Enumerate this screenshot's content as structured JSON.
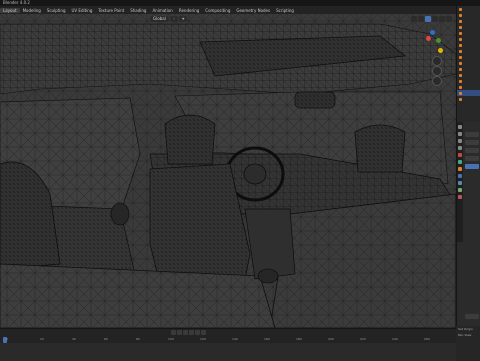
{
  "window": {
    "title": "Blender 4.0.2"
  },
  "menubar": {
    "items": [
      "Layout",
      "Modeling",
      "Sculpting",
      "UV Editing",
      "Texture Paint",
      "Shading",
      "Animation",
      "Rendering",
      "Compositing",
      "Geometry Nodes",
      "Scripting"
    ],
    "active_index": 0
  },
  "viewport_header": {
    "transform_orientation": "Global"
  },
  "timeline": {
    "ruler": [
      "0",
      "20",
      "40",
      "60",
      "80",
      "100",
      "120",
      "140",
      "160",
      "180",
      "200",
      "220",
      "240",
      "260"
    ]
  },
  "status_bar": {
    "items": [
      "Set Origin",
      "Pan View"
    ]
  },
  "colors": {
    "accent": "#4772b3",
    "object": "#e0812c",
    "wire": "#0d0d0d"
  }
}
